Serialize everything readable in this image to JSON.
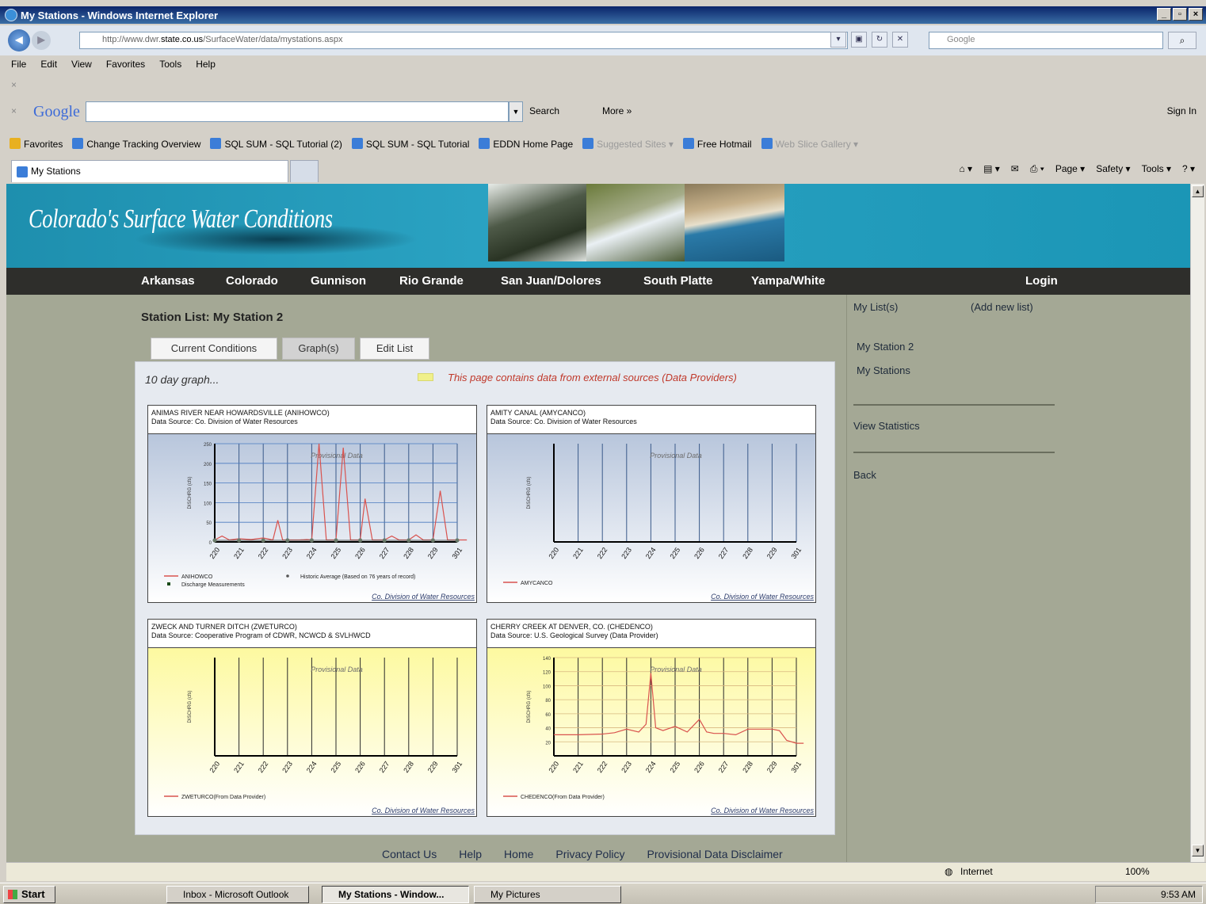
{
  "window": {
    "title": "My Stations - Windows Internet Explorer",
    "url_prefix": "http://www.dwr.",
    "url_domain": "state.co.us",
    "url_path": "/SurfaceWater/data/mystations.aspx",
    "search_placeholder": "Google"
  },
  "menu": [
    "File",
    "Edit",
    "View",
    "Favorites",
    "Tools",
    "Help"
  ],
  "google_toolbar": {
    "logo": "Google",
    "search_label": "Search",
    "more_label": "More »",
    "sign_in": "Sign In"
  },
  "favorites": {
    "label": "Favorites",
    "items": [
      {
        "label": "Change Tracking Overview",
        "dim": false
      },
      {
        "label": "SQL SUM - SQL Tutorial (2)",
        "dim": false
      },
      {
        "label": "SQL SUM - SQL Tutorial",
        "dim": false
      },
      {
        "label": "EDDN Home Page",
        "dim": false
      },
      {
        "label": "Suggested Sites ▾",
        "dim": true
      },
      {
        "label": "Free Hotmail",
        "dim": false
      },
      {
        "label": "Web Slice Gallery ▾",
        "dim": true
      }
    ]
  },
  "tab": {
    "label": "My Stations"
  },
  "command_bar": [
    "Page ▾",
    "Safety ▾",
    "Tools ▾"
  ],
  "site": {
    "banner_title": "Colorado's Surface Water Conditions",
    "nav": [
      "Arkansas",
      "Colorado",
      "Gunnison",
      "Rio Grande",
      "San Juan/Dolores",
      "South Platte",
      "Yampa/White"
    ],
    "login": "Login"
  },
  "page": {
    "heading": "Station List: My Station 2",
    "tabs": [
      "Current Conditions",
      "Graph(s)",
      "Edit List"
    ],
    "subheading": "10 day graph...",
    "note": "This page contains data from external sources (Data Providers)",
    "note_color": "#f0f08a"
  },
  "charts": [
    {
      "title": "ANIMAS RIVER NEAR HOWARDSVILLE (ANIHOWCO)",
      "source": "Data Source: Co. Division of Water Resources",
      "watermark": "Provisional Data",
      "ylabel": "DISCHRG (cfs)",
      "legend": [
        "ANIHOWCO",
        "Historic Average (Based on 76 years of record)",
        "Discharge Measurements"
      ],
      "credit": "Co. Division of Water Resources",
      "yticks": [
        "250",
        "200",
        "150",
        "100",
        "50",
        "0"
      ],
      "background": "blue"
    },
    {
      "title": "AMITY CANAL (AMYCANCO)",
      "source": "Data Source: Co. Division of Water Resources",
      "watermark": "Provisional Data",
      "ylabel": "DISCHRG (cfs)",
      "legend": [
        "AMYCANCO"
      ],
      "credit": "Co. Division of Water Resources",
      "yticks": [],
      "background": "blue"
    },
    {
      "title": "ZWECK AND TURNER DITCH (ZWETURCO)",
      "source": "Data Source: Cooperative Program of CDWR, NCWCD & SVLHWCD",
      "watermark": "Provisional Data",
      "ylabel": "DISCHRG (cfs)",
      "legend": [
        "ZWETURCO(From Data Provider)"
      ],
      "credit": "Co. Division of Water Resources",
      "yticks": [],
      "background": "yellow"
    },
    {
      "title": "CHERRY CREEK AT DENVER, CO. (CHEDENCO)",
      "source": "Data Source: U.S. Geological Survey (Data Provider)",
      "watermark": "Provisional Data",
      "ylabel": "DISCHRG (cfs)",
      "legend": [
        "CHEDENCO(From Data Provider)"
      ],
      "credit": "Co. Division of Water Resources",
      "yticks": [
        "140",
        "120",
        "100",
        "80",
        "60",
        "40",
        "20"
      ],
      "background": "yellow"
    }
  ],
  "chart_data": [
    {
      "type": "line",
      "title": "ANIMAS RIVER NEAR HOWARDSVILLE (ANIHOWCO)",
      "ylabel": "DISCHRG (cfs)",
      "ylim": [
        0,
        250
      ],
      "categories": [
        "2/20",
        "2/21",
        "2/22",
        "2/23",
        "2/24",
        "2/25",
        "2/26",
        "2/27",
        "2/28",
        "2/29",
        "3/01"
      ],
      "series": [
        {
          "name": "ANIHOWCO",
          "x": [
            0,
            0.3,
            0.6,
            1,
            1.5,
            2,
            2.4,
            2.6,
            2.8,
            3,
            3.5,
            3.8,
            4,
            4.3,
            4.6,
            5,
            5.3,
            5.6,
            6,
            6.2,
            6.5,
            7,
            7.3,
            7.6,
            8,
            8.3,
            8.6,
            9,
            9.3,
            9.6,
            10,
            10.4
          ],
          "values": [
            5,
            15,
            5,
            8,
            6,
            10,
            5,
            55,
            5,
            5,
            5,
            6,
            5,
            250,
            5,
            5,
            240,
            5,
            5,
            110,
            5,
            5,
            15,
            5,
            5,
            18,
            5,
            5,
            130,
            5,
            5,
            5
          ]
        },
        {
          "name": "Historic Average (Based on 76 years of record)",
          "x": [
            0,
            1,
            2,
            3,
            4,
            5,
            6,
            7,
            8,
            9,
            10
          ],
          "values": [
            4,
            4,
            4,
            4,
            4,
            4,
            4,
            4,
            4,
            4,
            4
          ]
        }
      ]
    },
    {
      "type": "line",
      "title": "AMITY CANAL (AMYCANCO)",
      "ylabel": "DISCHRG (cfs)",
      "categories": [
        "2/20",
        "2/21",
        "2/22",
        "2/23",
        "2/24",
        "2/25",
        "2/26",
        "2/27",
        "2/28",
        "2/29",
        "3/01"
      ],
      "series": [
        {
          "name": "AMYCANCO",
          "values": []
        }
      ]
    },
    {
      "type": "line",
      "title": "ZWECK AND TURNER DITCH (ZWETURCO)",
      "ylabel": "DISCHRG (cfs)",
      "categories": [
        "2/20",
        "2/21",
        "2/22",
        "2/23",
        "2/24",
        "2/25",
        "2/26",
        "2/27",
        "2/28",
        "2/29",
        "3/01"
      ],
      "series": [
        {
          "name": "ZWETURCO(From Data Provider)",
          "values": []
        }
      ]
    },
    {
      "type": "line",
      "title": "CHERRY CREEK AT DENVER, CO. (CHEDENCO)",
      "ylabel": "DISCHRG (cfs)",
      "ylim": [
        0,
        140
      ],
      "categories": [
        "2/20",
        "2/21",
        "2/22",
        "2/23",
        "2/24",
        "2/25",
        "2/26",
        "2/27",
        "2/28",
        "2/29",
        "3/01"
      ],
      "series": [
        {
          "name": "CHEDENCO(From Data Provider)",
          "x": [
            0,
            1,
            2,
            2.5,
            3,
            3.5,
            3.8,
            4,
            4.2,
            4.5,
            5,
            5.5,
            6,
            6.3,
            6.6,
            7,
            7.5,
            8,
            8.5,
            9,
            9.3,
            9.6,
            10,
            10.3
          ],
          "values": [
            30,
            30,
            31,
            33,
            38,
            34,
            45,
            118,
            40,
            36,
            42,
            34,
            52,
            34,
            32,
            32,
            30,
            38,
            38,
            38,
            36,
            22,
            18,
            18
          ]
        }
      ]
    }
  ],
  "sidebar": {
    "my_lists": "My List(s)",
    "add_new": "(Add new list)",
    "lists": [
      "My Station 2",
      "My Stations"
    ],
    "view_statistics": "View Statistics",
    "back": "Back"
  },
  "footer": [
    "Contact Us",
    "Help",
    "Home",
    "Privacy Policy",
    "Provisional Data Disclaimer"
  ],
  "statusbar": {
    "zone": "Internet",
    "zoom": "100%"
  },
  "taskbar": {
    "start": "Start",
    "buttons": [
      "Inbox - Microsoft Outlook",
      "My Stations - Window...",
      "My Pictures"
    ],
    "time": "9:53 AM"
  }
}
